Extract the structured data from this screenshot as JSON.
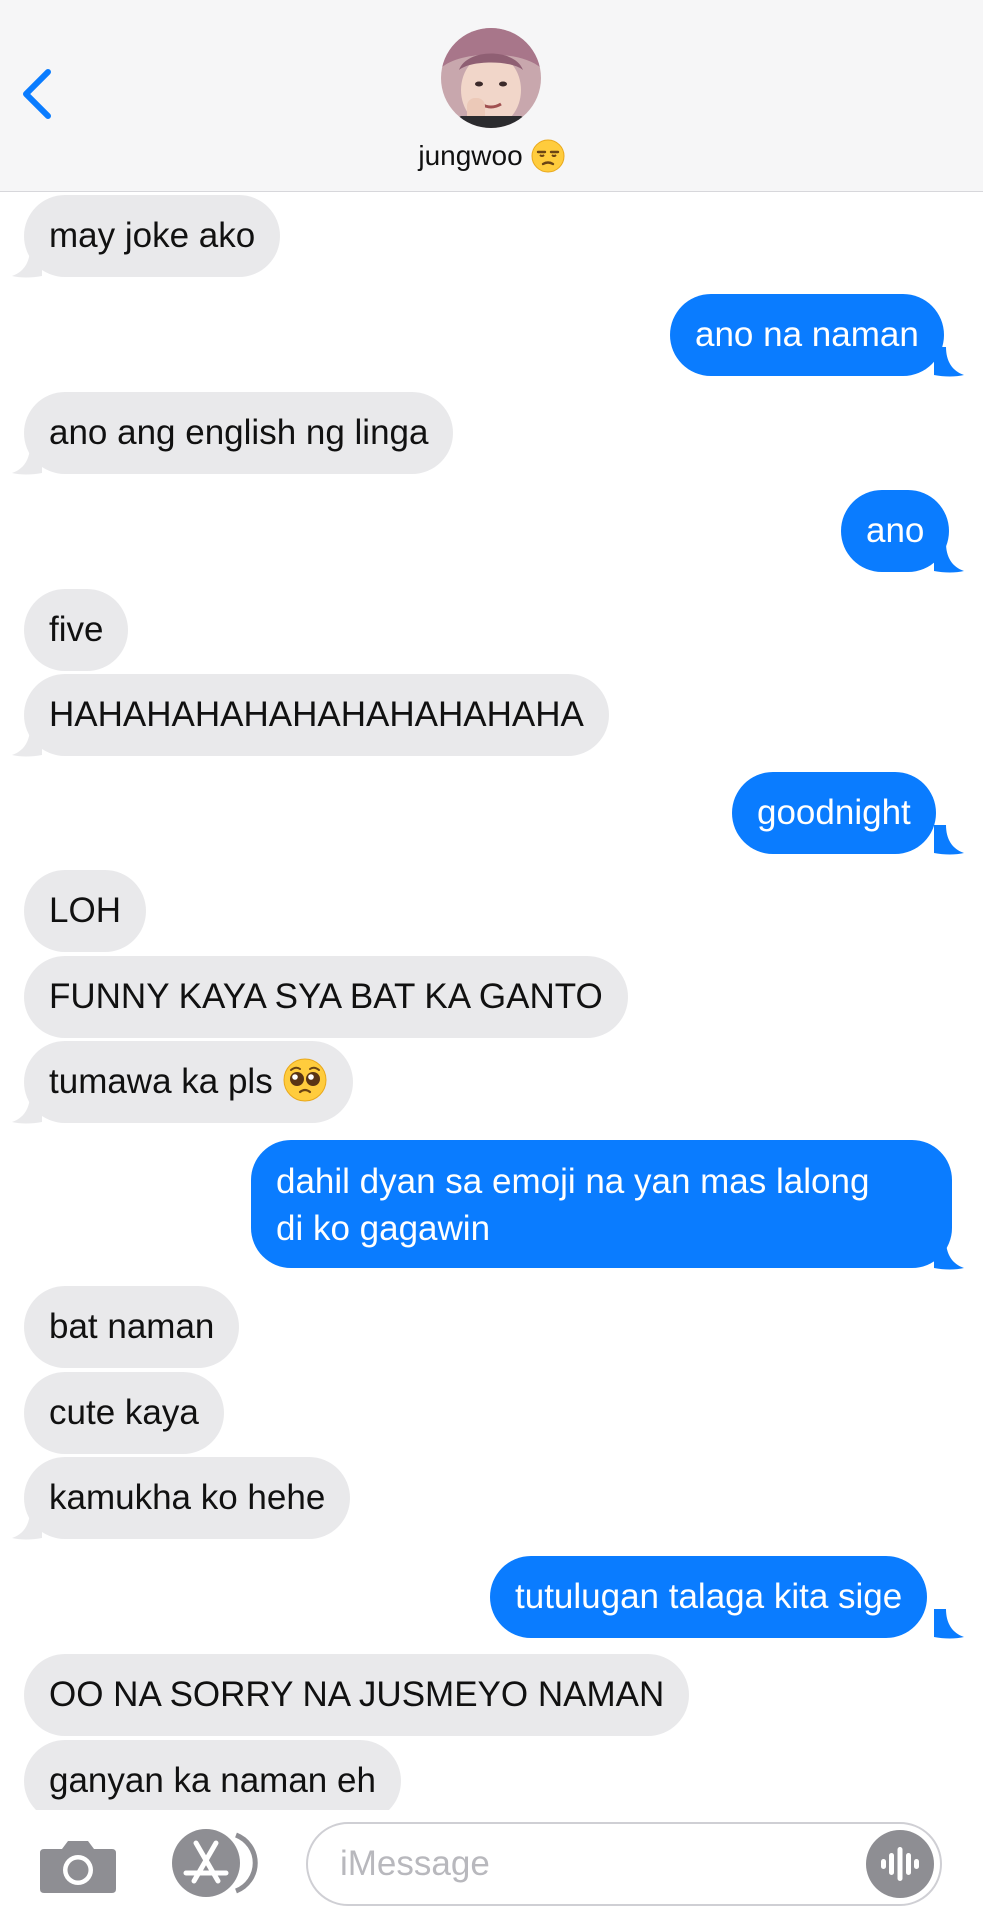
{
  "header": {
    "contact_name": "jungwoo",
    "contact_emoji": "unamused-face-emoji",
    "back_icon": "chevron-left-icon"
  },
  "messages": [
    {
      "side": "received",
      "text": "may joke ako"
    },
    {
      "side": "sent",
      "text": "ano na naman"
    },
    {
      "side": "received",
      "text": "ano ang english ng linga"
    },
    {
      "side": "sent",
      "text": "ano"
    },
    {
      "side": "received",
      "text": "five"
    },
    {
      "side": "received",
      "text": "HAHAHAHAHAHAHAHAHAHAHA"
    },
    {
      "side": "sent",
      "text": "goodnight"
    },
    {
      "side": "received",
      "text": "LOH"
    },
    {
      "side": "received",
      "text": "FUNNY KAYA SYA BAT KA GANTO"
    },
    {
      "side": "received",
      "text": "tumawa ka pls",
      "emoji": "pleading-face-emoji"
    },
    {
      "side": "sent",
      "text_line1": "dahil dyan sa emoji na yan mas lalong",
      "text_line2": "di ko gagawin"
    },
    {
      "side": "received",
      "text": "bat naman"
    },
    {
      "side": "received",
      "text": "cute kaya"
    },
    {
      "side": "received",
      "text": "kamukha ko hehe"
    },
    {
      "side": "sent",
      "text": "tutulugan talaga kita sige"
    },
    {
      "side": "received",
      "text": "OO NA SORRY NA JUSMEYO NAMAN"
    },
    {
      "side": "received",
      "text": "ganyan ka naman eh"
    }
  ],
  "composer": {
    "placeholder": "iMessage",
    "camera_icon": "camera-icon",
    "apps_icon": "app-store-icon",
    "audio_icon": "audio-waveform-icon"
  },
  "colors": {
    "sent_bubble": "#0a7cff",
    "received_bubble": "#e9e9eb",
    "header_bg": "#f6f6f7",
    "accent": "#0a7cff"
  }
}
